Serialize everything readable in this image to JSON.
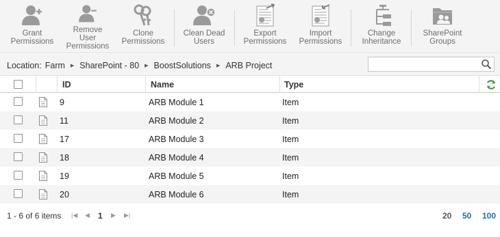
{
  "ribbon": {
    "buttons": [
      {
        "label": "Grant\nPermissions",
        "icon": "user-add-icon"
      },
      {
        "label": "Remove User\nPermissions",
        "icon": "user-remove-icon"
      },
      {
        "label": "Clone\nPermissions",
        "icon": "keys-icon"
      },
      {
        "label": "Clean Dead\nUsers",
        "icon": "user-delete-icon"
      },
      {
        "label": "Export\nPermissions",
        "icon": "export-document-icon"
      },
      {
        "label": "Import\nPermissions",
        "icon": "import-document-icon"
      },
      {
        "label": "Change\nInheritance",
        "icon": "hierarchy-icon"
      },
      {
        "label": "SharePoint\nGroups",
        "icon": "group-folder-icon"
      }
    ]
  },
  "breadcrumb": {
    "prefix": "Location:",
    "items": [
      "Farm",
      "SharePoint - 80",
      "BoostSolutions",
      "ARB Project"
    ]
  },
  "search": {
    "value": "",
    "placeholder": ""
  },
  "grid": {
    "columns": [
      "ID",
      "Name",
      "Type"
    ],
    "rows": [
      {
        "id": "9",
        "name": "ARB Module 1",
        "type": "Item"
      },
      {
        "id": "11",
        "name": "ARB Module 2",
        "type": "Item"
      },
      {
        "id": "17",
        "name": "ARB Module 3",
        "type": "Item"
      },
      {
        "id": "18",
        "name": "ARB Module 4",
        "type": "Item"
      },
      {
        "id": "19",
        "name": "ARB Module 5",
        "type": "Item"
      },
      {
        "id": "20",
        "name": "ARB Module 6",
        "type": "Item"
      }
    ]
  },
  "pager": {
    "info": "1 - 6 of 6 items",
    "current_page": "1",
    "page_sizes": [
      "20",
      "50",
      "100"
    ]
  },
  "colors": {
    "ribbon_bg": "#f4f4f4",
    "icon_gray": "#9a9a9a",
    "link_blue": "#1f6bb5",
    "refresh_green": "#3aa33a"
  }
}
